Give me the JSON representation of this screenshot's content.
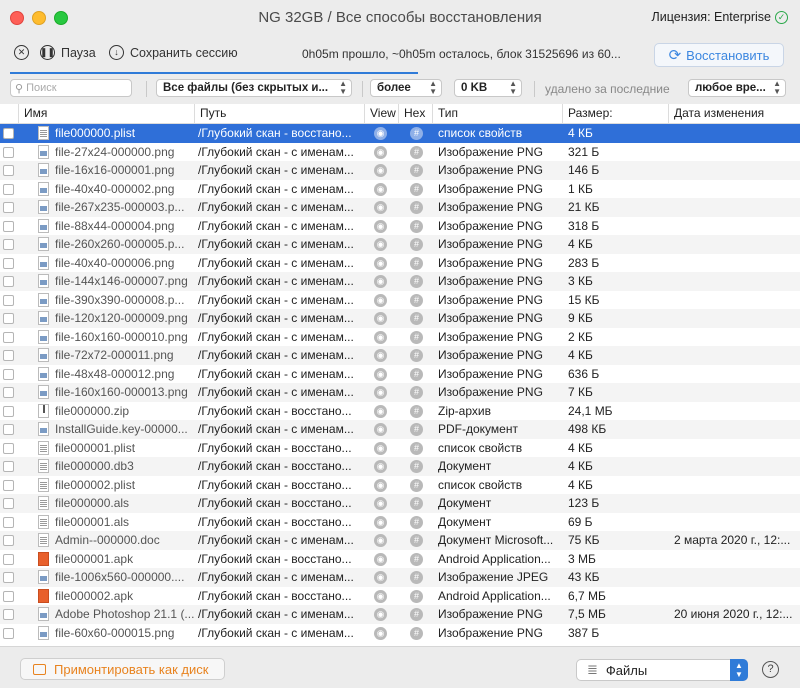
{
  "window": {
    "title": "NG 32GB / Все способы восстановления",
    "license": "Лицензия: Enterprise"
  },
  "toolbar": {
    "pause_label": "Пауза",
    "save_session_label": "Сохранить сессию",
    "status": "0h05m прошло, ~0h05m осталось, блок 31525696 из 60...",
    "restore_label": "Восстановить"
  },
  "filters": {
    "search_placeholder": "Поиск",
    "file_filter": "Все файлы (без скрытых и...",
    "size_compare": "более",
    "size_value": "0 KB",
    "deleted_label": "удалено за последние",
    "period": "любое вре..."
  },
  "table": {
    "columns": [
      "Имя",
      "Путь",
      "View",
      "Hex",
      "Тип",
      "Размер:",
      "Дата изменения"
    ],
    "rows": [
      {
        "icon": "doc-icon",
        "name": "file000000.plist",
        "path": "/Глубокий скан - восстано...",
        "type": "список свойств",
        "size": "4 КБ",
        "date": ""
      },
      {
        "icon": "png-icon",
        "name": "file-27x24-000000.png",
        "path": "/Глубокий скан - с именам...",
        "type": "Изображение PNG",
        "size": "321 Б",
        "date": ""
      },
      {
        "icon": "png-icon",
        "name": "file-16x16-000001.png",
        "path": "/Глубокий скан - с именам...",
        "type": "Изображение PNG",
        "size": "146 Б",
        "date": ""
      },
      {
        "icon": "png-icon",
        "name": "file-40x40-000002.png",
        "path": "/Глубокий скан - с именам...",
        "type": "Изображение PNG",
        "size": "1 КБ",
        "date": ""
      },
      {
        "icon": "png-icon",
        "name": "file-267x235-000003.p...",
        "path": "/Глубокий скан - с именам...",
        "type": "Изображение PNG",
        "size": "21 КБ",
        "date": ""
      },
      {
        "icon": "png-icon",
        "name": "file-88x44-000004.png",
        "path": "/Глубокий скан - с именам...",
        "type": "Изображение PNG",
        "size": "318 Б",
        "date": ""
      },
      {
        "icon": "png-icon",
        "name": "file-260x260-000005.p...",
        "path": "/Глубокий скан - с именам...",
        "type": "Изображение PNG",
        "size": "4 КБ",
        "date": ""
      },
      {
        "icon": "png-icon",
        "name": "file-40x40-000006.png",
        "path": "/Глубокий скан - с именам...",
        "type": "Изображение PNG",
        "size": "283 Б",
        "date": ""
      },
      {
        "icon": "png-icon",
        "name": "file-144x146-000007.png",
        "path": "/Глубокий скан - с именам...",
        "type": "Изображение PNG",
        "size": "3 КБ",
        "date": ""
      },
      {
        "icon": "png-icon",
        "name": "file-390x390-000008.p...",
        "path": "/Глубокий скан - с именам...",
        "type": "Изображение PNG",
        "size": "15 КБ",
        "date": ""
      },
      {
        "icon": "png-icon",
        "name": "file-120x120-000009.png",
        "path": "/Глубокий скан - с именам...",
        "type": "Изображение PNG",
        "size": "9 КБ",
        "date": ""
      },
      {
        "icon": "png-icon",
        "name": "file-160x160-000010.png",
        "path": "/Глубокий скан - с именам...",
        "type": "Изображение PNG",
        "size": "2 КБ",
        "date": ""
      },
      {
        "icon": "png-icon",
        "name": "file-72x72-000011.png",
        "path": "/Глубокий скан - с именам...",
        "type": "Изображение PNG",
        "size": "4 КБ",
        "date": ""
      },
      {
        "icon": "png-icon",
        "name": "file-48x48-000012.png",
        "path": "/Глубокий скан - с именам...",
        "type": "Изображение PNG",
        "size": "636 Б",
        "date": ""
      },
      {
        "icon": "png-icon",
        "name": "file-160x160-000013.png",
        "path": "/Глубокий скан - с именам...",
        "type": "Изображение PNG",
        "size": "7 КБ",
        "date": ""
      },
      {
        "icon": "zip-icon",
        "name": "file000000.zip",
        "path": "/Глубокий скан - восстано...",
        "type": "Zip-архив",
        "size": "24,1 МБ",
        "date": ""
      },
      {
        "icon": "png-icon",
        "name": "InstallGuide.key-00000...",
        "path": "/Глубокий скан - с именам...",
        "type": "PDF-документ",
        "size": "498 КБ",
        "date": ""
      },
      {
        "icon": "doc-icon",
        "name": "file000001.plist",
        "path": "/Глубокий скан - восстано...",
        "type": "список свойств",
        "size": "4 КБ",
        "date": ""
      },
      {
        "icon": "doc-icon",
        "name": "file000000.db3",
        "path": "/Глубокий скан - восстано...",
        "type": "Документ",
        "size": "4 КБ",
        "date": ""
      },
      {
        "icon": "doc-icon",
        "name": "file000002.plist",
        "path": "/Глубокий скан - восстано...",
        "type": "список свойств",
        "size": "4 КБ",
        "date": ""
      },
      {
        "icon": "doc-icon",
        "name": "file000000.als",
        "path": "/Глубокий скан - восстано...",
        "type": "Документ",
        "size": "123 Б",
        "date": ""
      },
      {
        "icon": "doc-icon",
        "name": "file000001.als",
        "path": "/Глубокий скан - восстано...",
        "type": "Документ",
        "size": "69 Б",
        "date": ""
      },
      {
        "icon": "doc-icon",
        "name": "Admin--000000.doc",
        "path": "/Глубокий скан - с именам...",
        "type": "Документ Microsoft...",
        "size": "75 КБ",
        "date": "2 марта 2020 г., 12:..."
      },
      {
        "icon": "apk-icon",
        "name": "file000001.apk",
        "path": "/Глубокий скан - восстано...",
        "type": "Android Application...",
        "size": "3 МБ",
        "date": ""
      },
      {
        "icon": "png-icon",
        "name": "file-1006x560-000000....",
        "path": "/Глубокий скан - с именам...",
        "type": "Изображение JPEG",
        "size": "43 КБ",
        "date": ""
      },
      {
        "icon": "apk-icon",
        "name": "file000002.apk",
        "path": "/Глубокий скан - восстано...",
        "type": "Android Application...",
        "size": "6,7 МБ",
        "date": ""
      },
      {
        "icon": "png-icon",
        "name": "Adobe Photoshop 21.1 (...",
        "path": "/Глубокий скан - с именам...",
        "type": "Изображение PNG",
        "size": "7,5 МБ",
        "date": "20 июня 2020 г., 12:..."
      },
      {
        "icon": "png-icon",
        "name": "file-60x60-000015.png",
        "path": "/Глубокий скан - с именам...",
        "type": "Изображение PNG",
        "size": "387 Б",
        "date": ""
      }
    ]
  },
  "bottom": {
    "mount_label": "Примонтировать как диск",
    "view_mode": "Файлы",
    "help": "?"
  },
  "colors": {
    "accent": "#2f7bd8",
    "selection": "#2f6fd8",
    "mount": "#e8831f"
  }
}
